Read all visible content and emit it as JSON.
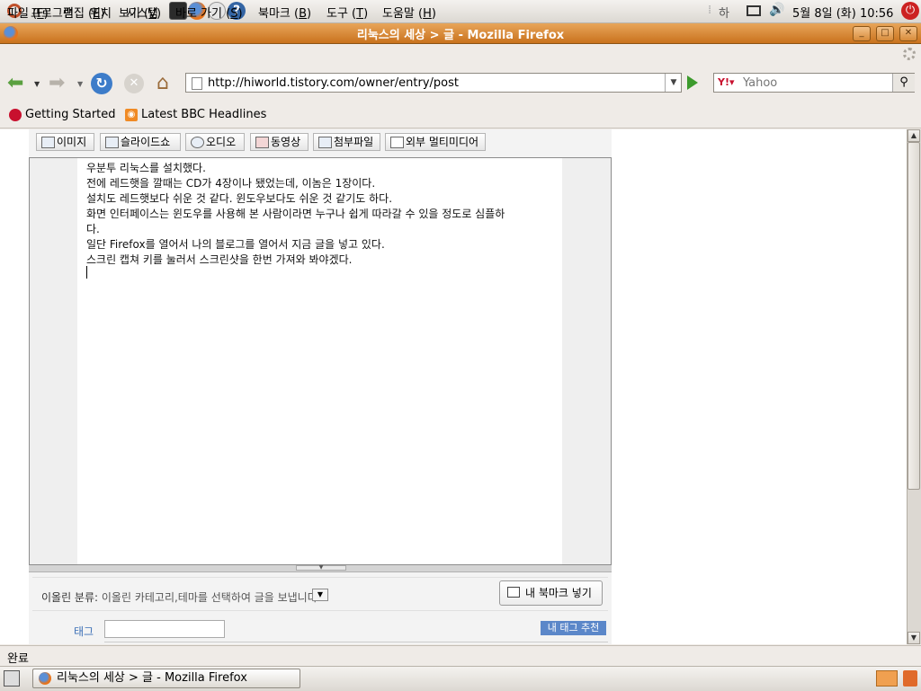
{
  "panel": {
    "menus": [
      "프로그램",
      "위치",
      "시스템"
    ],
    "input_method": "하",
    "clock": "5월  8일 (화) 10:56"
  },
  "window": {
    "title": "리눅스의 세상 > 글 - Mozilla Firefox"
  },
  "menubar": [
    {
      "label": "파일",
      "key": "F"
    },
    {
      "label": "편집",
      "key": "E"
    },
    {
      "label": "보기",
      "key": "V"
    },
    {
      "label": "바로 가기",
      "key": "S"
    },
    {
      "label": "북마크",
      "key": "B"
    },
    {
      "label": "도구",
      "key": "T"
    },
    {
      "label": "도움말",
      "key": "H"
    }
  ],
  "navbar": {
    "url": "http://hiworld.tistory.com/owner/entry/post",
    "search_placeholder": "Yahoo"
  },
  "bookmarks": [
    "Getting Started",
    "Latest BBC Headlines"
  ],
  "editor": {
    "toolbar": [
      "이미지",
      "슬라이드쇼",
      "오디오",
      "동영상",
      "첨부파일",
      "외부 멀티미디어"
    ],
    "lines": [
      "우분투 리눅스를 설치했다.",
      "전에 레드햇을 깔때는 CD가 4장이나 됐었는데, 이놈은 1장이다.",
      "설치도 레드햇보다 쉬운 것 같다. 윈도우보다도 쉬운 것 같기도 하다.",
      "화면 인터페이스는 윈도우를 사용해 본 사람이라면 누구나 쉽게 따라갈 수 있을 정도로 심플하",
      "다.",
      "일단 Firefox를 열어서 나의 블로그를 열어서 지금 글을 넣고 있다.",
      "스크린 캡쳐 키를 눌러서 스크린샷을 한번 가져와 봐야겠다."
    ],
    "category_label": "이올린 분류:",
    "category_text": "이올린 카테고리,테마를 선택하여 글을 보냅니다",
    "bookmark_button": "내 북마크 넣기",
    "tag_label": "태그",
    "tag_value": "",
    "tag_suggest": "내 태그 추천"
  },
  "status": "완료",
  "taskbar": {
    "task_title": "리눅스의 세상 > 글 - Mozilla Firefox"
  },
  "colors": {
    "titlebar": "#c9721d",
    "link_blue": "#3b6fb6",
    "tag_button": "#5b87c9"
  }
}
